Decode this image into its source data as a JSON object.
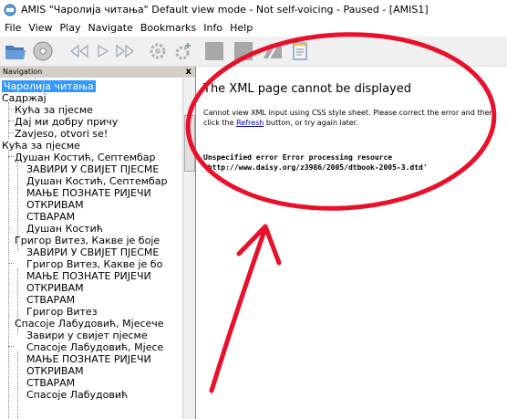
{
  "window": {
    "title": "AMIS \"Чаролија читања\" Default view mode - Not self-voicing - Paused - [AMIS1]"
  },
  "menu": [
    "File",
    "View",
    "Play",
    "Navigate",
    "Bookmarks",
    "Info",
    "Help"
  ],
  "toolbar": {
    "buttons": [
      "open-folder-icon",
      "cd-icon",
      "rewind-icon",
      "play-icon",
      "fast-forward-icon",
      "settings-icon",
      "settings-plus-icon",
      "block-icon",
      "block-icon",
      "book-icon",
      "notepad-icon"
    ]
  },
  "navigation": {
    "label": "Navigation",
    "close": "x",
    "items": [
      "Чаролија читања",
      "Садржај",
      "Кућа за пјесме",
      "Дај ми добру причу",
      "Zavjeso, otvori se!",
      "Кућа за пјесме",
      "Душан Костић, Септембар",
      "ЗАВИРИ У СВИЈЕТ ПЈЕСМЕ",
      "Душан Костић, Септембар",
      "МАЊЕ ПОЗНАТЕ РИЈЕЧИ",
      "ОТКРИВАМ",
      "СТВАРАМ",
      "Душан Костић",
      "Григор Витез, Какве је боје",
      "ЗАВИРИ У СВИЈЕТ ПЈЕСМЕ",
      "Григор Витез, Какве је бо",
      "МАЊЕ ПОЗНАТЕ РИЈЕЧИ",
      "ОТКРИВАМ",
      "СТВАРАМ",
      "Григор Витез",
      "Спасоје Лабудовић, Мјесече",
      "Завири у свијет пјесме",
      "Спасоје Лабудовић, Мјесе",
      "МАЊЕ ПОЗНАТЕ РИЈЕЧИ",
      "ОТКРИВАМ",
      "СТВАРАМ",
      "Спасоје Лабудовић"
    ]
  },
  "content": {
    "title": "The XML page cannot be displayed",
    "message_before": "Cannot view XML input using CSS style sheet. Please correct the error and then click the ",
    "refresh_link": "Refresh",
    "message_after": " button, or try again later.",
    "error_line1": "Unspecified error Error processing resource",
    "error_line2": "'http://www.daisy.org/z3986/2005/dtbook-2005-3.dtd'"
  },
  "annotation": {
    "color": "#e8102a"
  }
}
